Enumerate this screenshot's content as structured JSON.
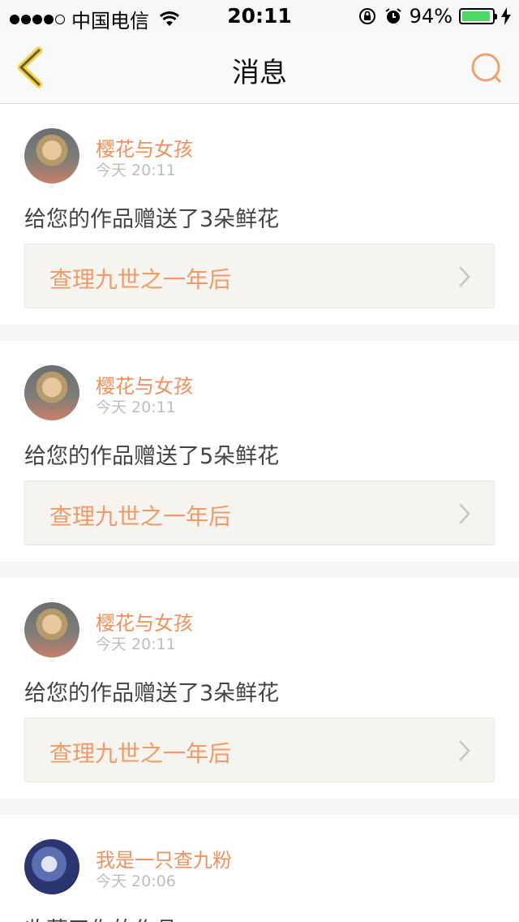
{
  "status_bar": {
    "carrier": "中国电信",
    "time": "20:11",
    "battery_percent_text": "94%",
    "battery_level": 0.94,
    "battery_color": "#4cd964"
  },
  "nav": {
    "title": "消息",
    "back_icon": "chevron-left-icon",
    "search_icon": "search-icon",
    "accent_color": "#f0915d"
  },
  "messages": [
    {
      "user": "樱花与女孩",
      "time": "今天 20:11",
      "text": "给您的作品赠送了3朵鲜花",
      "work": "查理九世之一年后",
      "avatar": "girl-avatar"
    },
    {
      "user": "樱花与女孩",
      "time": "今天 20:11",
      "text": "给您的作品赠送了5朵鲜花",
      "work": "查理九世之一年后",
      "avatar": "girl-avatar"
    },
    {
      "user": "樱花与女孩",
      "time": "今天 20:11",
      "text": "给您的作品赠送了3朵鲜花",
      "work": "查理九世之一年后",
      "avatar": "girl-avatar"
    },
    {
      "user": "我是一只查九粉",
      "time": "今天 20:06",
      "text": "收藏了你的作品",
      "avatar": "wolf-avatar"
    }
  ]
}
